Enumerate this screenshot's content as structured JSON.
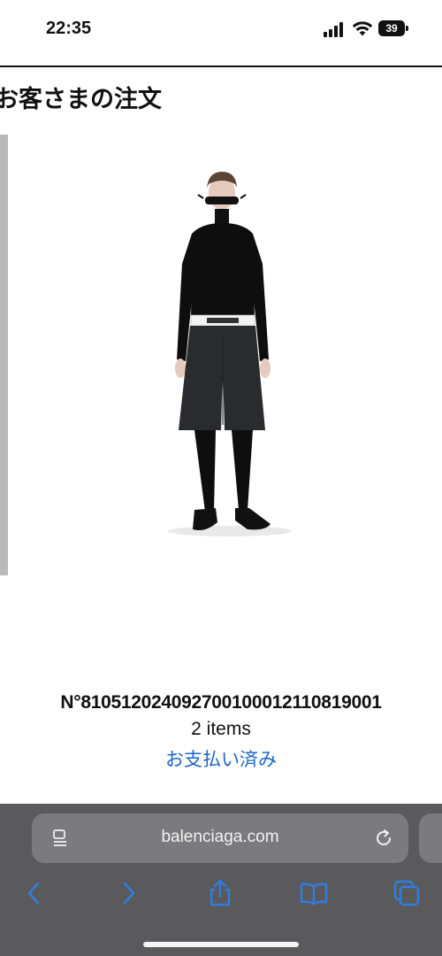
{
  "status_bar": {
    "time": "22:35",
    "battery_level": "39"
  },
  "page": {
    "title": "お客さまの注文"
  },
  "order": {
    "number": "N°81051202409270010001211081900​1",
    "items_count": "2 items",
    "payment_status": "お支払い済み"
  },
  "browser": {
    "domain": "balenciaga.com",
    "accent_color": "#2f7de1",
    "toolbar_icons": [
      "back-icon",
      "forward-icon",
      "share-icon",
      "bookmarks-icon",
      "tabs-icon"
    ]
  }
}
